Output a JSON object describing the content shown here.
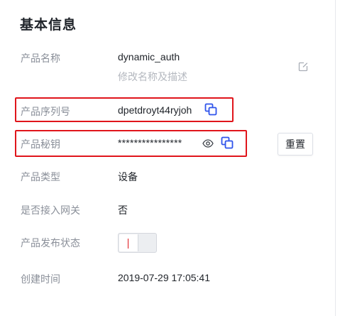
{
  "section": {
    "title": "基本信息"
  },
  "fields": {
    "product_name": {
      "label": "产品名称",
      "value": "dynamic_auth",
      "desc": "修改名称及描述"
    },
    "product_serial": {
      "label": "产品序列号",
      "value": "dpetdroyt44ryjoh"
    },
    "product_secret": {
      "label": "产品秘钥",
      "value": "****************",
      "reset_label": "重置"
    },
    "product_type": {
      "label": "产品类型",
      "value": "设备"
    },
    "network_access": {
      "label": "是否接入网关",
      "value": "否"
    },
    "publish_status": {
      "label": "产品发布状态",
      "toggle_on": false
    },
    "created_time": {
      "label": "创建时间",
      "value": "2019-07-29 17:05:41"
    }
  },
  "icons": {
    "edit": "edit-icon",
    "copy": "copy-icon",
    "view": "eye-icon"
  },
  "colors": {
    "accent": "#2f54eb",
    "highlight": "#e0151b"
  }
}
